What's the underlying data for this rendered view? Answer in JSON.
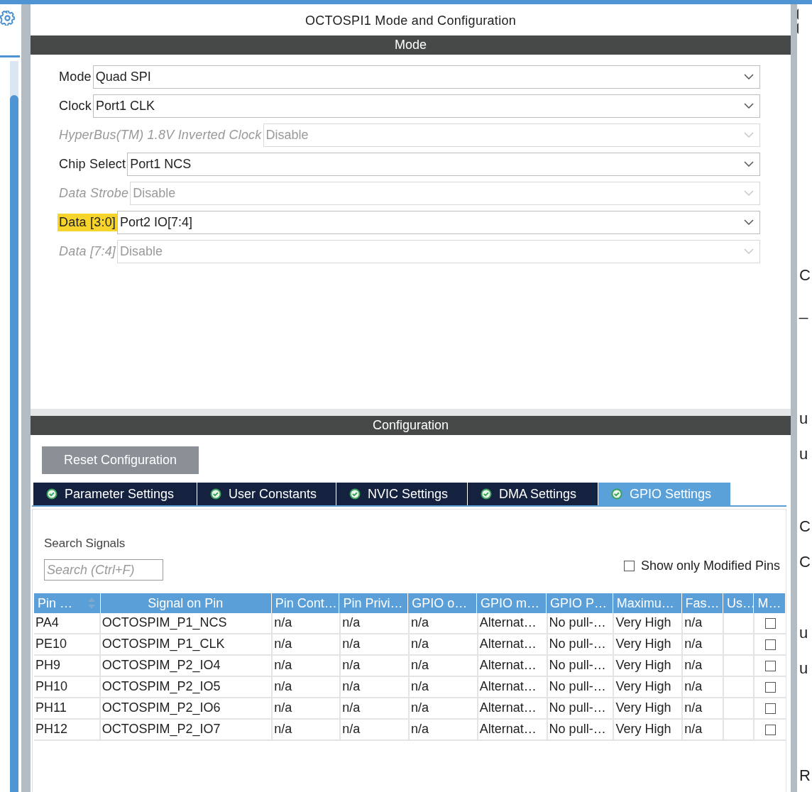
{
  "title": "OCTOSPI1 Mode and Configuration",
  "mode": {
    "heading": "Mode",
    "fields": [
      {
        "label": "Mode",
        "value": "Quad SPI",
        "disabled": false,
        "highlighted": false
      },
      {
        "label": "Clock",
        "value": "Port1 CLK",
        "disabled": false,
        "highlighted": false
      },
      {
        "label": "HyperBus(TM) 1.8V Inverted Clock",
        "value": "Disable",
        "disabled": true,
        "highlighted": false
      },
      {
        "label": "Chip Select",
        "value": "Port1 NCS",
        "disabled": false,
        "highlighted": false
      },
      {
        "label": "Data Strobe",
        "value": "Disable",
        "disabled": true,
        "highlighted": false
      },
      {
        "label": "Data [3:0]",
        "value": "Port2 IO[7:4]",
        "disabled": false,
        "highlighted": true
      },
      {
        "label": "Data [7:4]",
        "value": "Disable",
        "disabled": true,
        "highlighted": false
      }
    ]
  },
  "configuration": {
    "heading": "Configuration",
    "reset_button": "Reset Configuration",
    "tabs": [
      {
        "label": "Parameter Settings",
        "selected": false
      },
      {
        "label": "User Constants",
        "selected": false
      },
      {
        "label": "NVIC Settings",
        "selected": false
      },
      {
        "label": "DMA Settings",
        "selected": false
      },
      {
        "label": "GPIO Settings",
        "selected": true
      }
    ],
    "search_label": "Search Signals",
    "search": {
      "placeholder": "Search (Ctrl+F)"
    },
    "show_modified": {
      "label": "Show only Modified Pins",
      "checked": false
    },
    "table": {
      "columns": [
        "Pin …",
        "Signal on Pin",
        "Pin Cont…",
        "Pin Privi…",
        "GPIO o…",
        "GPIO m…",
        "GPIO P…",
        "Maximu…",
        "Fas…",
        "Us…",
        "M…"
      ],
      "rows": [
        {
          "cells": [
            "PA4",
            "OCTOSPIM_P1_NCS",
            "n/a",
            "n/a",
            "n/a",
            "Alternat…",
            "No pull-…",
            "Very High",
            "n/a",
            ""
          ],
          "checked": false
        },
        {
          "cells": [
            "PE10",
            "OCTOSPIM_P1_CLK",
            "n/a",
            "n/a",
            "n/a",
            "Alternat…",
            "No pull-…",
            "Very High",
            "n/a",
            ""
          ],
          "checked": false
        },
        {
          "cells": [
            "PH9",
            "OCTOSPIM_P2_IO4",
            "n/a",
            "n/a",
            "n/a",
            "Alternat…",
            "No pull-…",
            "Very High",
            "n/a",
            ""
          ],
          "checked": false
        },
        {
          "cells": [
            "PH10",
            "OCTOSPIM_P2_IO5",
            "n/a",
            "n/a",
            "n/a",
            "Alternat…",
            "No pull-…",
            "Very High",
            "n/a",
            ""
          ],
          "checked": false
        },
        {
          "cells": [
            "PH11",
            "OCTOSPIM_P2_IO6",
            "n/a",
            "n/a",
            "n/a",
            "Alternat…",
            "No pull-…",
            "Very High",
            "n/a",
            ""
          ],
          "checked": false
        },
        {
          "cells": [
            "PH12",
            "OCTOSPIM_P2_IO7",
            "n/a",
            "n/a",
            "n/a",
            "Alternat…",
            "No pull-…",
            "Very High",
            "n/a",
            ""
          ],
          "checked": false
        }
      ]
    }
  },
  "right_strip": [
    "C",
    "_",
    "u",
    "u",
    "C",
    "C",
    "u",
    "u",
    "R"
  ]
}
